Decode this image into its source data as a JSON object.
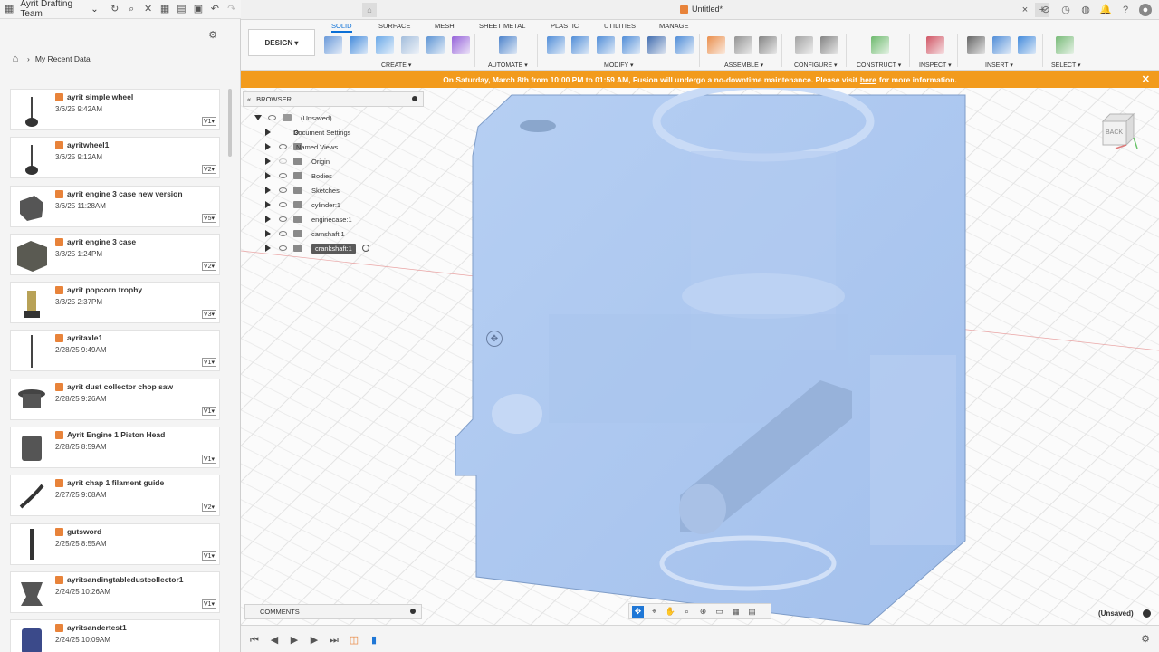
{
  "left_panel": {
    "team_name": "Ayrit Drafting Team",
    "breadcrumb": "My Recent Data",
    "files": [
      {
        "name": "ayrit simple wheel",
        "date": "3/6/25 9:42AM",
        "version": "V1"
      },
      {
        "name": "ayritwheel1",
        "date": "3/6/25 9:12AM",
        "version": "V2"
      },
      {
        "name": "ayrit engine 3 case new version",
        "date": "3/6/25 11:28AM",
        "version": "V5"
      },
      {
        "name": "ayrit engine 3 case",
        "date": "3/3/25 1:24PM",
        "version": "V2"
      },
      {
        "name": "ayrit popcorn trophy",
        "date": "3/3/25 2:37PM",
        "version": "V3"
      },
      {
        "name": "ayritaxle1",
        "date": "2/28/25 9:49AM",
        "version": "V1"
      },
      {
        "name": "ayrit dust collector chop saw",
        "date": "2/28/25 9:26AM",
        "version": "V1"
      },
      {
        "name": "Ayrit Engine 1 Piston Head",
        "date": "2/28/25 8:59AM",
        "version": "V1"
      },
      {
        "name": "ayrit chap 1 filament guide",
        "date": "2/27/25 9:08AM",
        "version": "V2"
      },
      {
        "name": "gutsword",
        "date": "2/25/25 8:55AM",
        "version": "V1"
      },
      {
        "name": "ayritsandingtabledustcollector1",
        "date": "2/24/25 10:26AM",
        "version": "V1"
      },
      {
        "name": "ayritsandertest1",
        "date": "2/24/25 10:09AM",
        "version": ""
      }
    ]
  },
  "tab": {
    "title": "Untitled*",
    "close": "×"
  },
  "ribbon": {
    "workspace": "DESIGN",
    "tabs": [
      "SOLID",
      "SURFACE",
      "MESH",
      "SHEET METAL",
      "PLASTIC",
      "UTILITIES",
      "MANAGE"
    ],
    "groups": [
      "CREATE",
      "AUTOMATE",
      "MODIFY",
      "ASSEMBLE",
      "CONFIGURE",
      "CONSTRUCT",
      "INSPECT",
      "INSERT",
      "SELECT"
    ]
  },
  "banner": {
    "text_before": "On Saturday, March 8th from 10:00 PM to 01:59 AM, Fusion will undergo a no-downtime maintenance. Please visit",
    "link": "here",
    "text_after": "for more information."
  },
  "browser": {
    "title": "BROWSER",
    "root": "(Unsaved)",
    "items": [
      "Document Settings",
      "Named Views",
      "Origin",
      "Bodies",
      "Sketches",
      "cylinder:1",
      "enginecase:1",
      "camshaft:1",
      "crankshaft:1"
    ]
  },
  "viewcube": {
    "face": "BACK"
  },
  "comments": {
    "title": "COMMENTS"
  },
  "status": {
    "unsaved": "(Unsaved)"
  },
  "colors": {
    "accent": "#0a6fd6",
    "banner": "#f29b1d",
    "model": "#a9c6ee"
  }
}
